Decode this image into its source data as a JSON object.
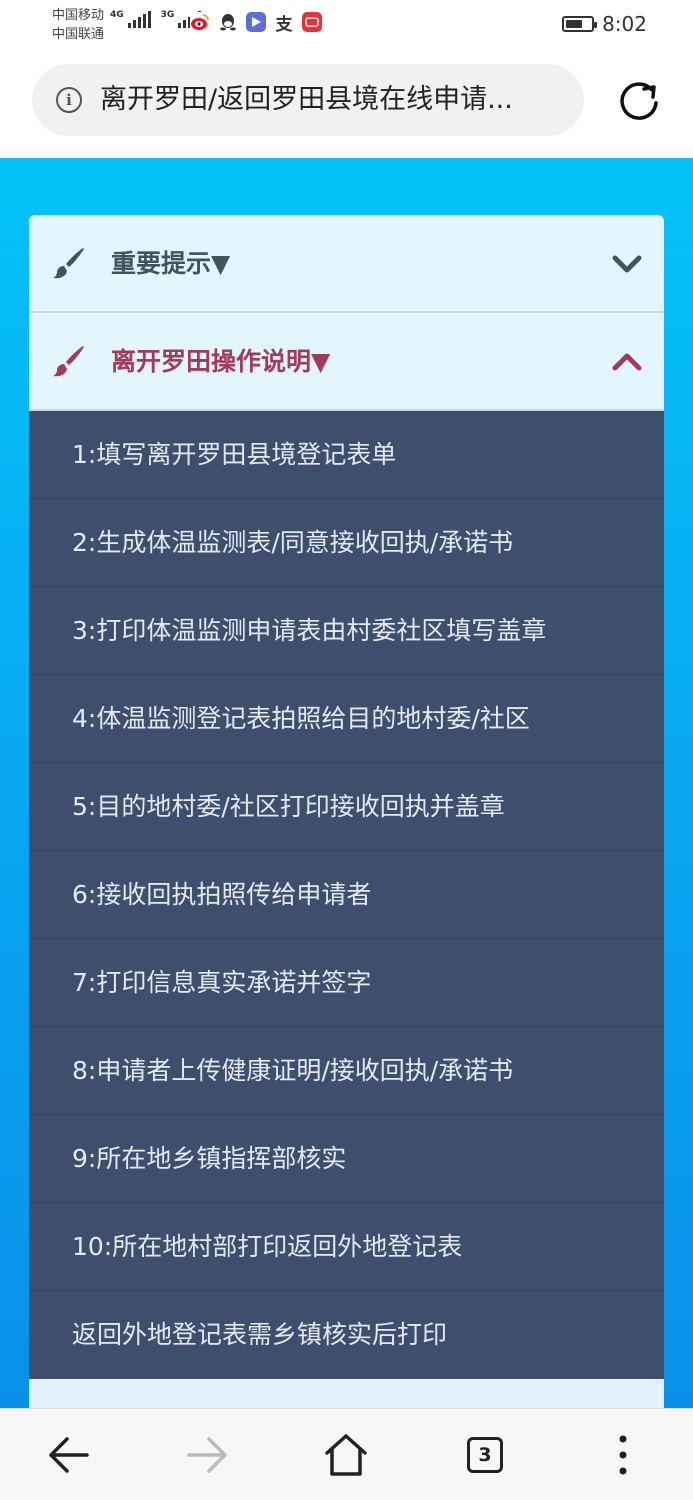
{
  "status_bar": {
    "carrier_1": "中国移动",
    "carrier_2": "中国联通",
    "net_1": "4G",
    "net_2": "3G",
    "app_icons": [
      "weibo-icon",
      "qq-icon",
      "video-app-icon",
      "alipay-icon",
      "huawei-app-icon"
    ],
    "battery_level": 0.65,
    "time": "8:02"
  },
  "browser": {
    "url_title": "离开罗田/返回罗田县境在线申请...",
    "icons": {
      "info": "info-icon",
      "reload": "reload-icon"
    }
  },
  "accordion": {
    "colors": {
      "header_bg": "#e3f6fd",
      "body_bg": "#3e4e6d",
      "red": "#a23b5b",
      "dark": "#3f545e"
    },
    "sections": [
      {
        "title": "重要提示▼",
        "expanded": false,
        "icon": "brush-icon"
      },
      {
        "title": "离开罗田操作说明▼",
        "expanded": true,
        "icon": "brush-icon",
        "steps": [
          "1:填写离开罗田县境登记表单",
          "2:生成体温监测表/同意接收回执/承诺书",
          "3:打印体温监测申请表由村委社区填写盖章",
          "4:体温监测登记表拍照给目的地村委/社区",
          "5:目的地村委/社区打印接收回执并盖章",
          "6:接收回执拍照传给申请者",
          "7:打印信息真实承诺并签字",
          "8:申请者上传健康证明/接收回执/承诺书",
          "9:所在地乡镇指挥部核实",
          "10:所在地村部打印返回外地登记表",
          "返回外地登记表需乡镇核实后打印"
        ]
      }
    ]
  },
  "bottom_nav": {
    "icons": [
      "back-arrow-icon",
      "forward-arrow-icon",
      "home-icon",
      "tabs-icon",
      "more-menu-icon"
    ],
    "tab_count": "3"
  }
}
